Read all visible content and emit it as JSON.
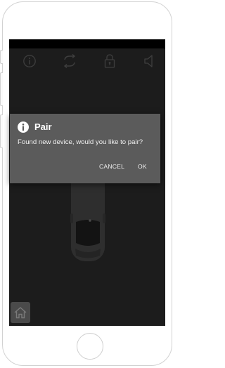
{
  "toolbar": {
    "icons": [
      "info-icon",
      "sync-icon",
      "lock-icon",
      "speaker-icon"
    ]
  },
  "dialog": {
    "title": "Pair",
    "message": "Found new device, would you like to pair?",
    "cancel_label": "CANCEL",
    "ok_label": "OK"
  },
  "colors": {
    "screen_background": "#2a2a2a",
    "dialog_background": "#5b5b5b",
    "status_bar": "#000000",
    "toolbar_icon": "#5c5c5c"
  },
  "home_icon": "house-icon"
}
